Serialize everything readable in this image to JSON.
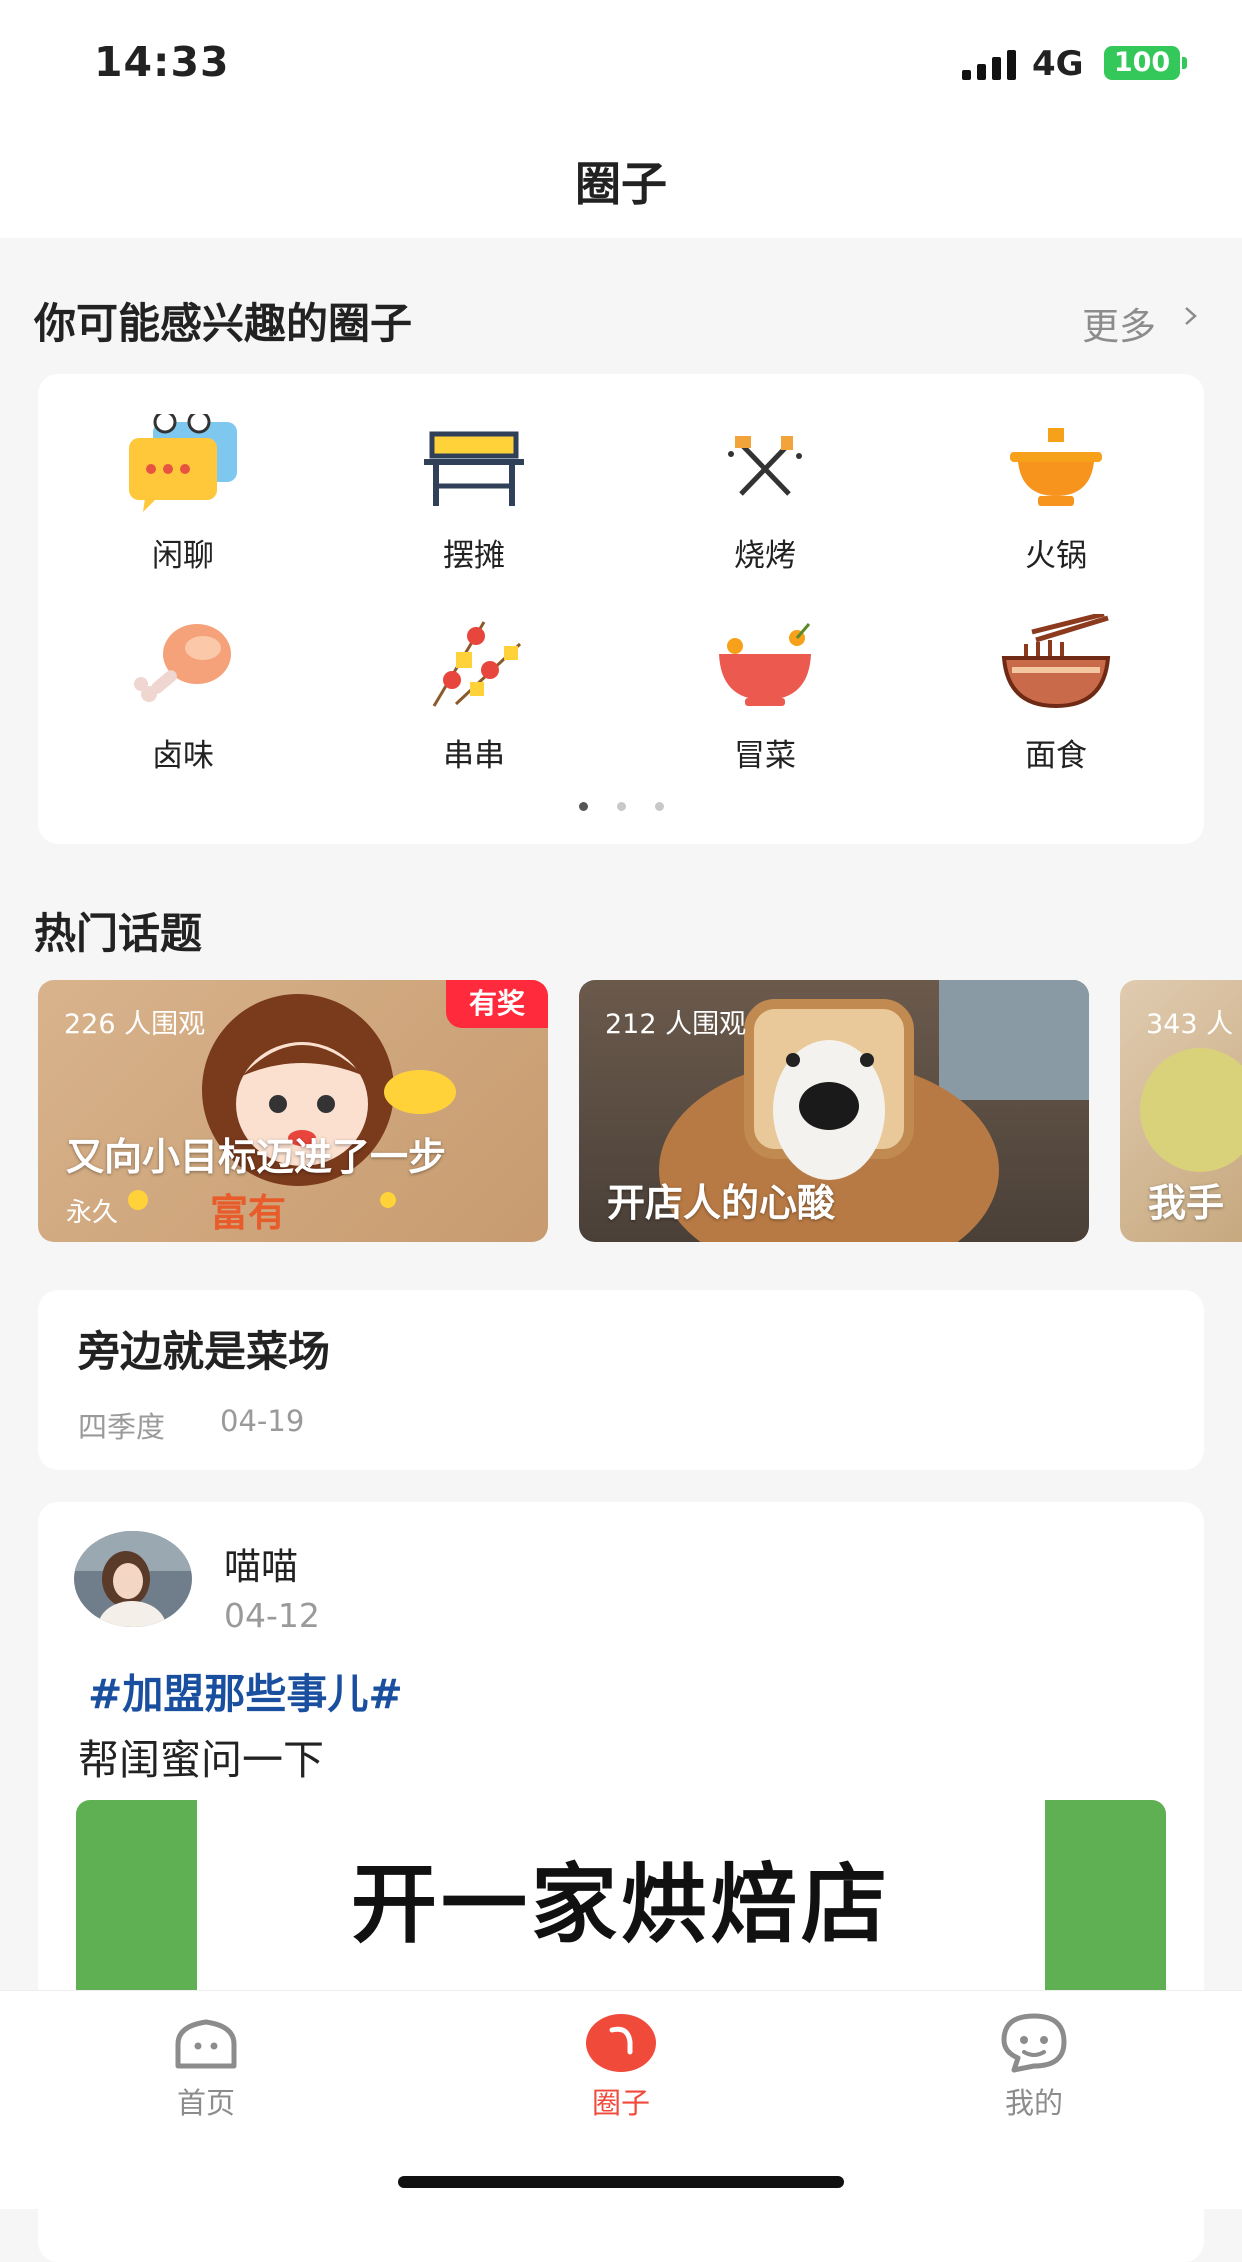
{
  "status_bar": {
    "time": "14:33",
    "network": "4G",
    "battery": "100"
  },
  "header": {
    "title": "圈子"
  },
  "interest_section": {
    "title": "你可能感兴趣的圈子",
    "more": "更多",
    "categories": [
      {
        "label": "闲聊",
        "icon": "chat-bubbles-icon"
      },
      {
        "label": "摆摊",
        "icon": "stall-table-icon"
      },
      {
        "label": "烧烤",
        "icon": "bbq-tools-icon"
      },
      {
        "label": "火锅",
        "icon": "hotpot-icon"
      },
      {
        "label": "卤味",
        "icon": "drumstick-icon"
      },
      {
        "label": "串串",
        "icon": "skewers-icon"
      },
      {
        "label": "冒菜",
        "icon": "bowl-icon"
      },
      {
        "label": "面食",
        "icon": "noodles-icon"
      }
    ]
  },
  "hot_topics": {
    "title": "热门话题",
    "items": [
      {
        "views": "226 人围观",
        "badge": "有奖",
        "title": "又向小目标迈进了一步",
        "subtitle": "永久"
      },
      {
        "views": "212 人围观",
        "title": "开店人的心酸"
      },
      {
        "views": "343 人",
        "title": "我手"
      }
    ]
  },
  "question_card": {
    "title": "旁边就是菜场",
    "author": "四季度",
    "date": "04-19"
  },
  "post": {
    "user": "喵喵",
    "date": "04-12",
    "hashtag": "#加盟那些事儿#",
    "text": "帮闺蜜问一下",
    "image_text": "开一家烘焙店"
  },
  "tabbar": {
    "tabs": [
      {
        "label": "首页",
        "active": false
      },
      {
        "label": "圈子",
        "active": true
      },
      {
        "label": "我的",
        "active": false
      }
    ],
    "active_color": "#f04a3a",
    "inactive_color": "#8c8c8c"
  },
  "colors": {
    "accent": "#f04a3a",
    "hashtag": "#1a4fa0",
    "badge": "#ff2a3c"
  }
}
